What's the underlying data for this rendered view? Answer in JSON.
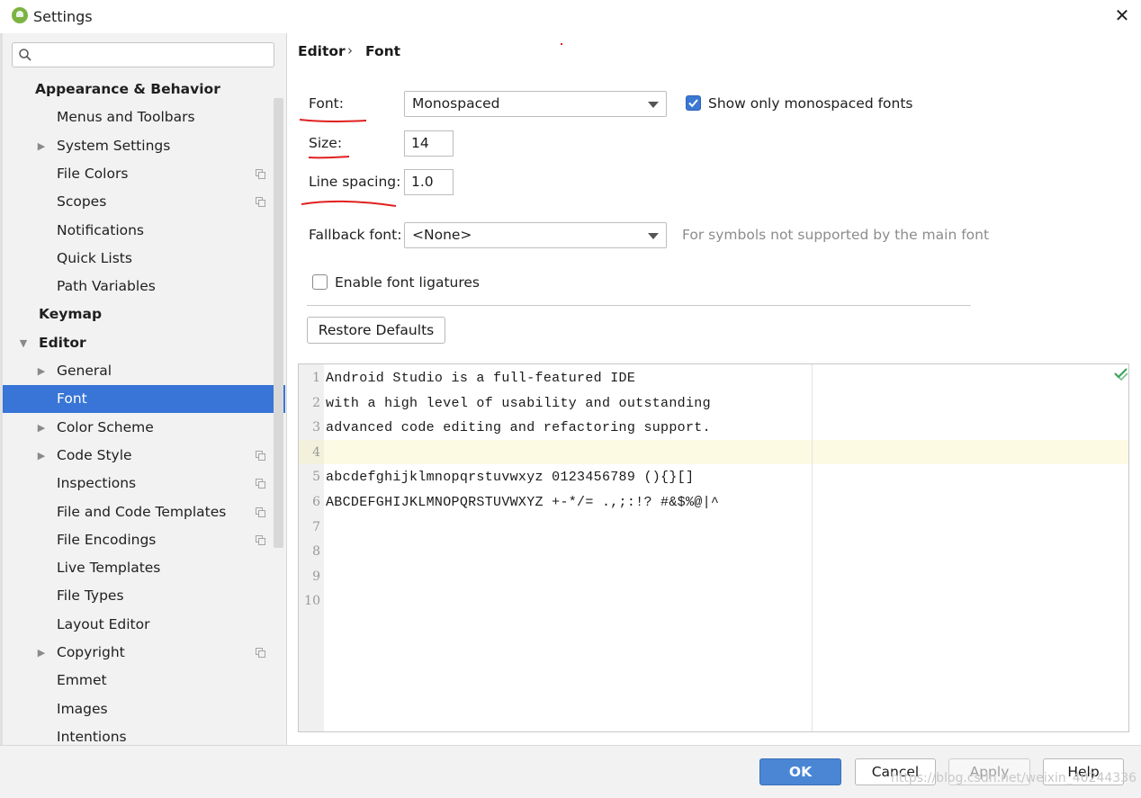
{
  "window": {
    "title": "Settings",
    "close_icon": "close-icon"
  },
  "sidebar": {
    "search": {
      "value": "",
      "placeholder": "",
      "icon": "search-icon"
    },
    "items": [
      {
        "label": "Appearance & Behavior",
        "level": 0,
        "bold": true,
        "arrow": "",
        "copy_icon": false,
        "selected": false
      },
      {
        "label": "Menus and Toolbars",
        "level": 1,
        "bold": false,
        "arrow": "",
        "copy_icon": false,
        "selected": false
      },
      {
        "label": "System Settings",
        "level": 1,
        "bold": false,
        "arrow": "collapsed",
        "copy_icon": false,
        "selected": false
      },
      {
        "label": "File Colors",
        "level": 1,
        "bold": false,
        "arrow": "",
        "copy_icon": true,
        "selected": false
      },
      {
        "label": "Scopes",
        "level": 1,
        "bold": false,
        "arrow": "",
        "copy_icon": true,
        "selected": false
      },
      {
        "label": "Notifications",
        "level": 1,
        "bold": false,
        "arrow": "",
        "copy_icon": false,
        "selected": false
      },
      {
        "label": "Quick Lists",
        "level": 1,
        "bold": false,
        "arrow": "",
        "copy_icon": false,
        "selected": false
      },
      {
        "label": "Path Variables",
        "level": 1,
        "bold": false,
        "arrow": "",
        "copy_icon": false,
        "selected": false
      },
      {
        "label": "Keymap",
        "level": 0,
        "bold": true,
        "arrow": "",
        "copy_icon": false,
        "selected": false
      },
      {
        "label": "Editor",
        "level": 0,
        "bold": true,
        "arrow": "expanded",
        "copy_icon": false,
        "selected": false
      },
      {
        "label": "General",
        "level": 1,
        "bold": false,
        "arrow": "collapsed",
        "copy_icon": false,
        "selected": false
      },
      {
        "label": "Font",
        "level": 1,
        "bold": false,
        "arrow": "",
        "copy_icon": false,
        "selected": true
      },
      {
        "label": "Color Scheme",
        "level": 1,
        "bold": false,
        "arrow": "collapsed",
        "copy_icon": false,
        "selected": false
      },
      {
        "label": "Code Style",
        "level": 1,
        "bold": false,
        "arrow": "collapsed",
        "copy_icon": true,
        "selected": false
      },
      {
        "label": "Inspections",
        "level": 1,
        "bold": false,
        "arrow": "",
        "copy_icon": true,
        "selected": false
      },
      {
        "label": "File and Code Templates",
        "level": 1,
        "bold": false,
        "arrow": "",
        "copy_icon": true,
        "selected": false
      },
      {
        "label": "File Encodings",
        "level": 1,
        "bold": false,
        "arrow": "",
        "copy_icon": true,
        "selected": false
      },
      {
        "label": "Live Templates",
        "level": 1,
        "bold": false,
        "arrow": "",
        "copy_icon": false,
        "selected": false
      },
      {
        "label": "File Types",
        "level": 1,
        "bold": false,
        "arrow": "",
        "copy_icon": false,
        "selected": false
      },
      {
        "label": "Layout Editor",
        "level": 1,
        "bold": false,
        "arrow": "",
        "copy_icon": false,
        "selected": false
      },
      {
        "label": "Copyright",
        "level": 1,
        "bold": false,
        "arrow": "collapsed",
        "copy_icon": true,
        "selected": false
      },
      {
        "label": "Emmet",
        "level": 1,
        "bold": false,
        "arrow": "",
        "copy_icon": false,
        "selected": false
      },
      {
        "label": "Images",
        "level": 1,
        "bold": false,
        "arrow": "",
        "copy_icon": false,
        "selected": false
      },
      {
        "label": "Intentions",
        "level": 1,
        "bold": false,
        "arrow": "",
        "copy_icon": false,
        "selected": false
      }
    ]
  },
  "breadcrumb": {
    "parent": "Editor",
    "separator": "›",
    "current": "Font"
  },
  "form": {
    "font_label": "Font:",
    "font_value": "Monospaced",
    "show_mono_label": "Show only monospaced fonts",
    "show_mono_checked": true,
    "size_label": "Size:",
    "size_value": "14",
    "line_spacing_label": "Line spacing:",
    "line_spacing_value": "1.0",
    "fallback_label": "Fallback font:",
    "fallback_value": "<None>",
    "fallback_hint": "For symbols not supported by the main font",
    "ligatures_label": "Enable font ligatures",
    "ligatures_checked": false,
    "restore_label": "Restore Defaults"
  },
  "preview": {
    "lines": [
      {
        "num": "1",
        "text": "Android Studio is a full-featured IDE"
      },
      {
        "num": "2",
        "text": "with a high level of usability and outstanding"
      },
      {
        "num": "3",
        "text": "advanced code editing and refactoring support."
      },
      {
        "num": "4",
        "text": ""
      },
      {
        "num": "5",
        "text": "abcdefghijklmnopqrstuvwxyz 0123456789 (){}[]"
      },
      {
        "num": "6",
        "text": "ABCDEFGHIJKLMNOPQRSTUVWXYZ +-*/= .,;:!? #&$%@|^"
      },
      {
        "num": "7",
        "text": ""
      },
      {
        "num": "8",
        "text": ""
      },
      {
        "num": "9",
        "text": ""
      },
      {
        "num": "10",
        "text": ""
      }
    ],
    "status_icon": "check-icon"
  },
  "footer": {
    "ok": "OK",
    "cancel": "Cancel",
    "apply": "Apply",
    "help": "Help",
    "watermark": "https://blog.csdn.net/weixin_40244336"
  },
  "colors": {
    "selection": "#3875d7",
    "ok_button": "#4a86d4",
    "annotation_red": "#e02020",
    "current_line": "#fdfae3",
    "checkbox_blue": "#3a78d4"
  }
}
